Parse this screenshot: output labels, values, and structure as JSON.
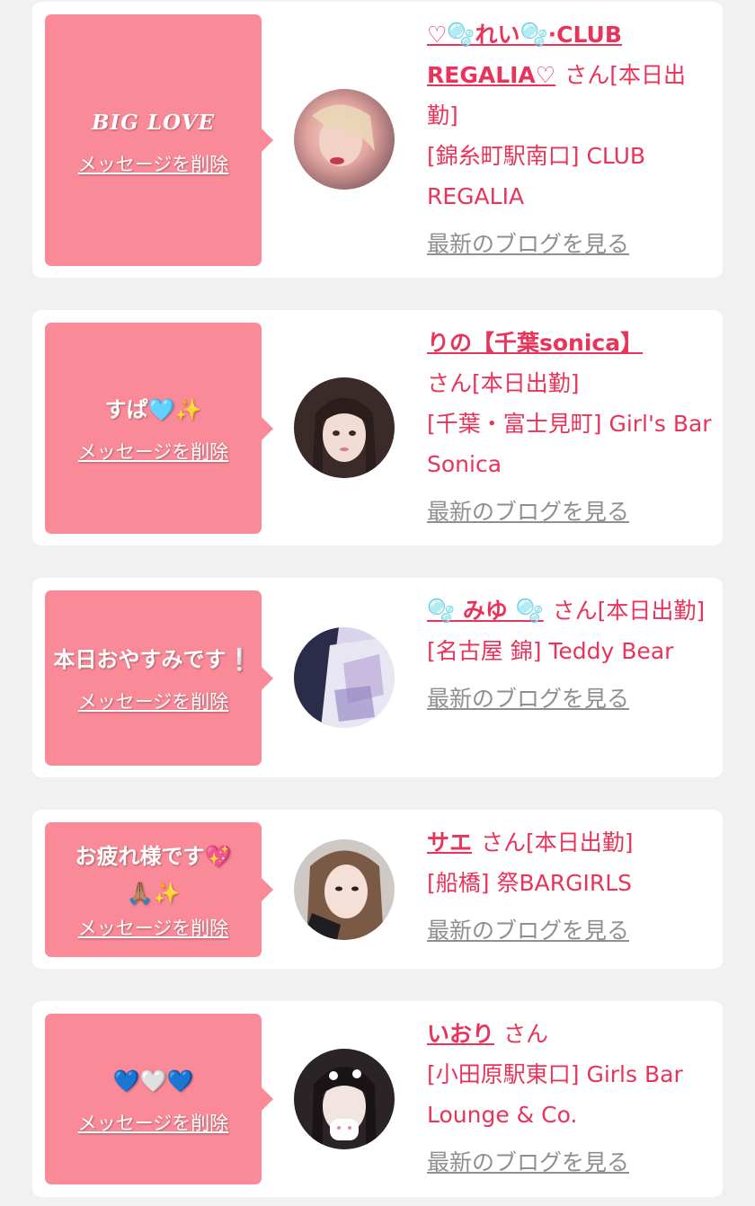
{
  "entries": [
    {
      "message": "BIG LOVE",
      "message_style": "serif",
      "delete_label": "メッセージを削除",
      "name": "♡🫧れい🫧·CLUB REGALIA♡",
      "suffix": "さん[本日出勤]",
      "shop": "[錦糸町駅南口] CLUB REGALIA",
      "blog_label": "最新のブログを見る"
    },
    {
      "message": "すぱ🩵✨",
      "message_style": "sans",
      "delete_label": "メッセージを削除",
      "name": "りの【千葉sonica】",
      "suffix": "さん[本日出勤]",
      "shop": "[千葉・富士見町] Girl's Bar Sonica",
      "blog_label": "最新のブログを見る"
    },
    {
      "message": "本日おやすみです❕",
      "message_style": "sans",
      "delete_label": "メッセージを削除",
      "name": "🫧 みゆ 🫧",
      "suffix": "さん[本日出勤]",
      "shop": "[名古屋 錦] Teddy Bear",
      "blog_label": "最新のブログを見る"
    },
    {
      "message": "お疲れ様です💖🙏🏽✨",
      "message_style": "sans",
      "delete_label": "メッセージを削除",
      "name": "サエ",
      "suffix": "さん[本日出勤]",
      "shop": "[船橋] 祭BARGIRLS",
      "blog_label": "最新のブログを見る"
    },
    {
      "message": "💙🤍💙",
      "message_style": "sans",
      "delete_label": "メッセージを削除",
      "name": "いおり",
      "suffix": "さん",
      "shop": "[小田原駅東口] Girls Bar Lounge & Co.",
      "blog_label": "最新のブログを見る"
    }
  ]
}
